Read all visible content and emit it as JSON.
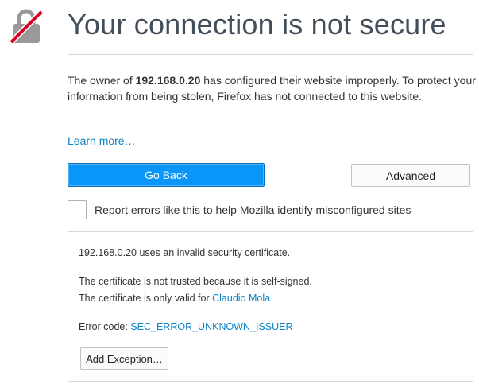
{
  "page": {
    "title": "Your connection is not secure",
    "icon": "broken-lock-icon"
  },
  "description": {
    "prefix": "The owner of ",
    "host": "192.168.0.20",
    "suffix": " has configured their website improperly. To protect your information from being stolen, Firefox has not connected to this website."
  },
  "learn_more": "Learn more…",
  "buttons": {
    "go_back": "Go Back",
    "advanced": "Advanced",
    "add_exception": "Add Exception…"
  },
  "report": {
    "checked": false,
    "label": "Report errors like this to help Mozilla identify misconfigured sites"
  },
  "details": {
    "invalid_cert": "192.168.0.20 uses an invalid security certificate.",
    "not_trusted": "The certificate is not trusted because it is self-signed.",
    "valid_for_prefix": "The certificate is only valid for ",
    "valid_for_name": "Claudio Mola",
    "error_code_label": "Error code: ",
    "error_code": "SEC_ERROR_UNKNOWN_ISSUER"
  },
  "colors": {
    "accent": "#0996f8",
    "link": "#0a84c7",
    "icon_slash": "#d70022",
    "icon_gray": "#999999"
  }
}
